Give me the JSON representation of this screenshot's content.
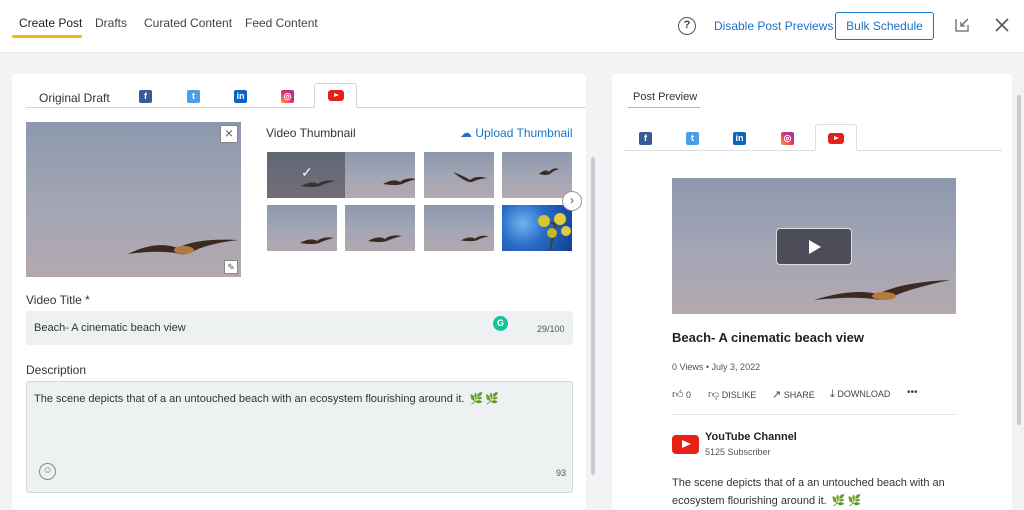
{
  "header": {
    "tabs": [
      {
        "label": "Create Post",
        "active": true
      },
      {
        "label": "Drafts"
      },
      {
        "label": "Curated Content"
      },
      {
        "label": "Feed Content"
      }
    ],
    "help_icon": "question-circle-icon",
    "disable_previews": "Disable Post Previews",
    "bulk_schedule": "Bulk Schedule"
  },
  "editor": {
    "original_draft_tab": "Original Draft",
    "network_tabs": [
      "facebook-icon",
      "twitter-icon",
      "linkedin-icon",
      "instagram-icon",
      "youtube-icon"
    ],
    "active_network": "youtube",
    "video_thumbnail_label": "Video Thumbnail",
    "upload_thumbnail": "Upload Thumbnail",
    "selected_thumbnail_index": 0,
    "video_title_label": "Video Title *",
    "video_title_value": "Beach- A cinematic beach view",
    "title_count": "29/100",
    "description_label": "Description",
    "description_value": "The scene depicts that of a an untouched beach with an ecosystem flourishing around it.",
    "description_count": "93"
  },
  "preview": {
    "label": "Post Preview",
    "video_title": "Beach- A cinematic beach view",
    "views": "0 Views",
    "date": "July 3, 2022",
    "meta_separator": "•",
    "likes": "0",
    "dislike": "DISLIKE",
    "share": "SHARE",
    "download": "DOWNLOAD",
    "more": "•••",
    "channel_name": "YouTube Channel",
    "subscribers": "5125 Subscriber",
    "description": "The scene depicts that of a an untouched beach with an ecosystem flourishing around it."
  },
  "colors": {
    "accent": "#1a73c9",
    "active_tab_underline": "#f5b800",
    "youtube_red": "#e62117"
  }
}
